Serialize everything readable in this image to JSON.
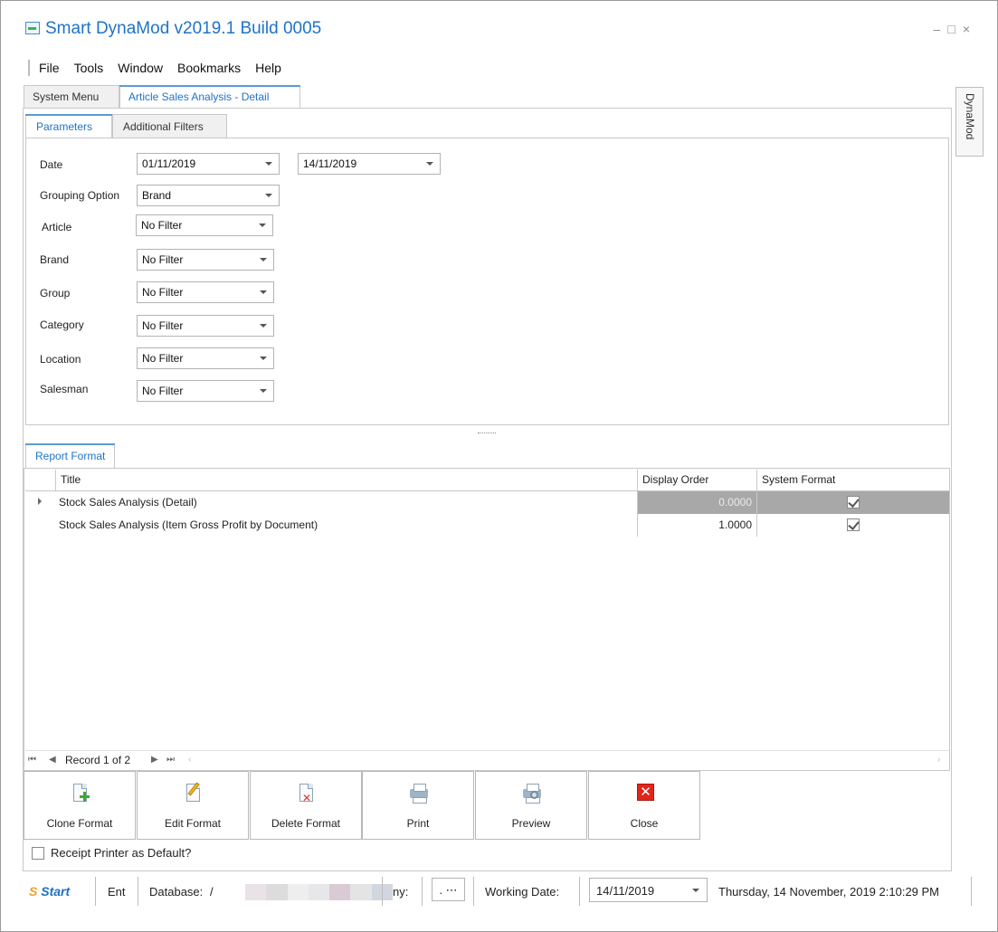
{
  "window": {
    "title": "Smart DynaMod v2019.1 Build 0005",
    "controls": {
      "minimize": "–",
      "maximize": "□",
      "close": "×"
    }
  },
  "menu": [
    "File",
    "Tools",
    "Window",
    "Bookmarks",
    "Help"
  ],
  "doc_tabs": [
    {
      "label": "System Menu",
      "active": false
    },
    {
      "label": "Article Sales Analysis - Detail",
      "active": true
    }
  ],
  "side_tab": "DynaMod",
  "param_tabs": [
    {
      "label": "Parameters",
      "active": true
    },
    {
      "label": "Additional Filters",
      "active": false
    }
  ],
  "params": {
    "date_label": "Date",
    "date_from": "01/11/2019",
    "date_to": "14/11/2019",
    "grouping_label": "Grouping Option",
    "grouping_value": "Brand",
    "article_label": "Article",
    "article_value": "No Filter",
    "brand_label": "Brand",
    "brand_value": "No Filter",
    "group_label": "Group",
    "group_value": "No Filter",
    "category_label": "Category",
    "category_value": "No Filter",
    "location_label": "Location",
    "location_value": "No Filter",
    "salesman_label": "Salesman",
    "salesman_value": "No Filter"
  },
  "report_format": {
    "tab_label": "Report Format",
    "columns": [
      "Title",
      "Display Order",
      "System Format"
    ],
    "rows": [
      {
        "title": "Stock Sales Analysis (Detail)",
        "display_order": "0.0000",
        "system_format": true,
        "selected": true
      },
      {
        "title": "Stock Sales Analysis (Item Gross Profit by Document)",
        "display_order": "1.0000",
        "system_format": true,
        "selected": false
      }
    ],
    "navigator": {
      "first": "⏮",
      "prev": "◀",
      "record_text": "Record 1 of 2",
      "next": "▶",
      "last": "⏭",
      "scroll_left": "‹",
      "scroll_right": "›"
    }
  },
  "actions": {
    "clone": "Clone Format",
    "edit": "Edit Format",
    "delete": "Delete Format",
    "print": "Print",
    "preview": "Preview",
    "close": "Close",
    "close_glyph": "✕",
    "delete_glyph": "✕"
  },
  "receipt_printer_label": "Receipt Printer as Default?",
  "receipt_printer_checked": false,
  "status": {
    "logo_text": "Start",
    "logo_prefix": "S",
    "ent": "Ent",
    "database_label": "Database:",
    "database_value": "/",
    "company_label": "ny:",
    "company_button": ". ⋯",
    "working_date_label": "Working Date:",
    "working_date_value": "14/11/2019",
    "timestamp": "Thursday, 14 November, 2019 2:10:29 PM"
  },
  "colors": {
    "accent": "#1e73c8",
    "selected_row": "#a8a8a8",
    "close_red": "#e1251b"
  }
}
